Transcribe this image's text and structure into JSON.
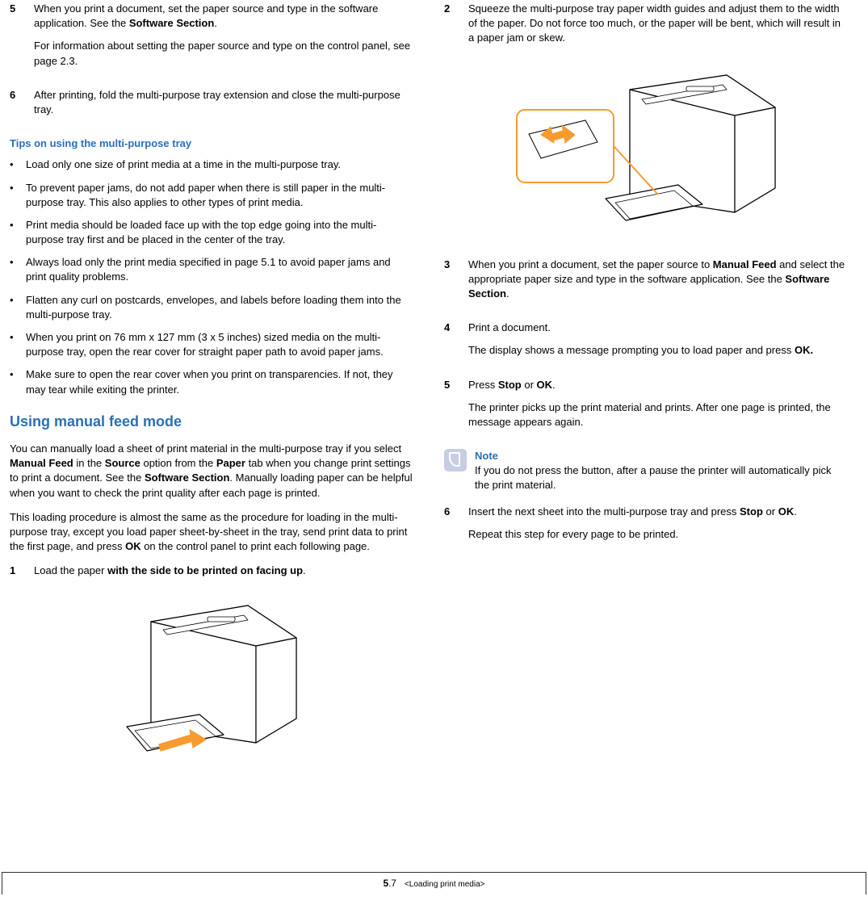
{
  "left": {
    "step5_a": "When you print a document, set the paper source and type in the software application. See the ",
    "step5_bold": "Software Section",
    "step5_a2": ".",
    "step5_b": "For information about setting the paper source and type on the control panel, see page 2.3.",
    "step6": "After printing, fold the multi-purpose tray extension and close the multi-purpose tray.",
    "tips_heading": "Tips on using the multi-purpose tray",
    "tips": [
      "Load only one size of print media at a time in the multi-purpose tray.",
      "To prevent paper jams, do not add paper when there is still paper in the multi-purpose tray. This also applies to other types of print media.",
      "Print media should be loaded face up with the top edge going into the multi-purpose tray first and be placed in the center of the tray.",
      "Always load only the print media specified in page 5.1 to avoid paper jams and print quality problems.",
      "Flatten any curl on postcards, envelopes, and labels before loading them into the multi-purpose tray.",
      "When you print on 76 mm x 127 mm (3 x 5 inches) sized media on the multi-purpose tray, open the rear cover for straight paper path to avoid paper jams.",
      "Make sure to open the rear cover when you print on transparencies. If not, they may tear while exiting the printer."
    ],
    "h2": "Using manual feed mode",
    "p1_a": "You can manually load a sheet of print material in the multi-purpose tray if you select ",
    "p1_b1": "Manual Feed",
    "p1_c": " in the ",
    "p1_b2": "Source",
    "p1_d": " option from the ",
    "p1_b3": "Paper",
    "p1_e": " tab when you change print settings to print a document. See the ",
    "p1_b4": "Software Section",
    "p1_f": ". Manually loading paper can be helpful when you want to check the print quality after each page is printed.",
    "p2_a": "This loading procedure is almost the same as the procedure for loading in the multi-purpose tray, except you load paper sheet-by-sheet in the tray, send print data to print the first page, and press ",
    "p2_b": "OK",
    "p2_c": " on the control panel to print each following page.",
    "step1_a": "Load the paper ",
    "step1_b": "with the side to be printed on facing up",
    "step1_c": "."
  },
  "right": {
    "step2": "Squeeze the multi-purpose tray paper width guides and adjust them to the width of the paper. Do not force too much, or the paper will be bent, which will result in a paper jam or skew.",
    "step3_a": "When you print a document, set the paper source to ",
    "step3_b1": "Manual Feed",
    "step3_b": " and select the appropriate paper size and type in the software application. See the ",
    "step3_b2": "Software Section",
    "step3_c": ".",
    "step4_a": "Print a document.",
    "step4_b_a": "The display shows a message prompting you to load paper and press ",
    "step4_b_b": "OK.",
    "step5_a": "Press ",
    "step5_b1": "Stop",
    "step5_b": " or ",
    "step5_b2": "OK",
    "step5_c": ".",
    "step5_d": "The printer picks up the print material and prints. After one page is printed, the message appears again.",
    "note_label": "Note",
    "note_body": "If you do not press the button, after a pause the printer will automatically pick the print material.",
    "step6_a": "Insert the next sheet into the multi-purpose tray and press ",
    "step6_b1": "Stop",
    "step6_b": " or ",
    "step6_b2": "OK",
    "step6_c": ".",
    "step6_d": "Repeat this step for every page to be printed."
  },
  "footer": {
    "chapter": "5",
    "dot": ".",
    "page": "7",
    "title": "<Loading print media>"
  }
}
